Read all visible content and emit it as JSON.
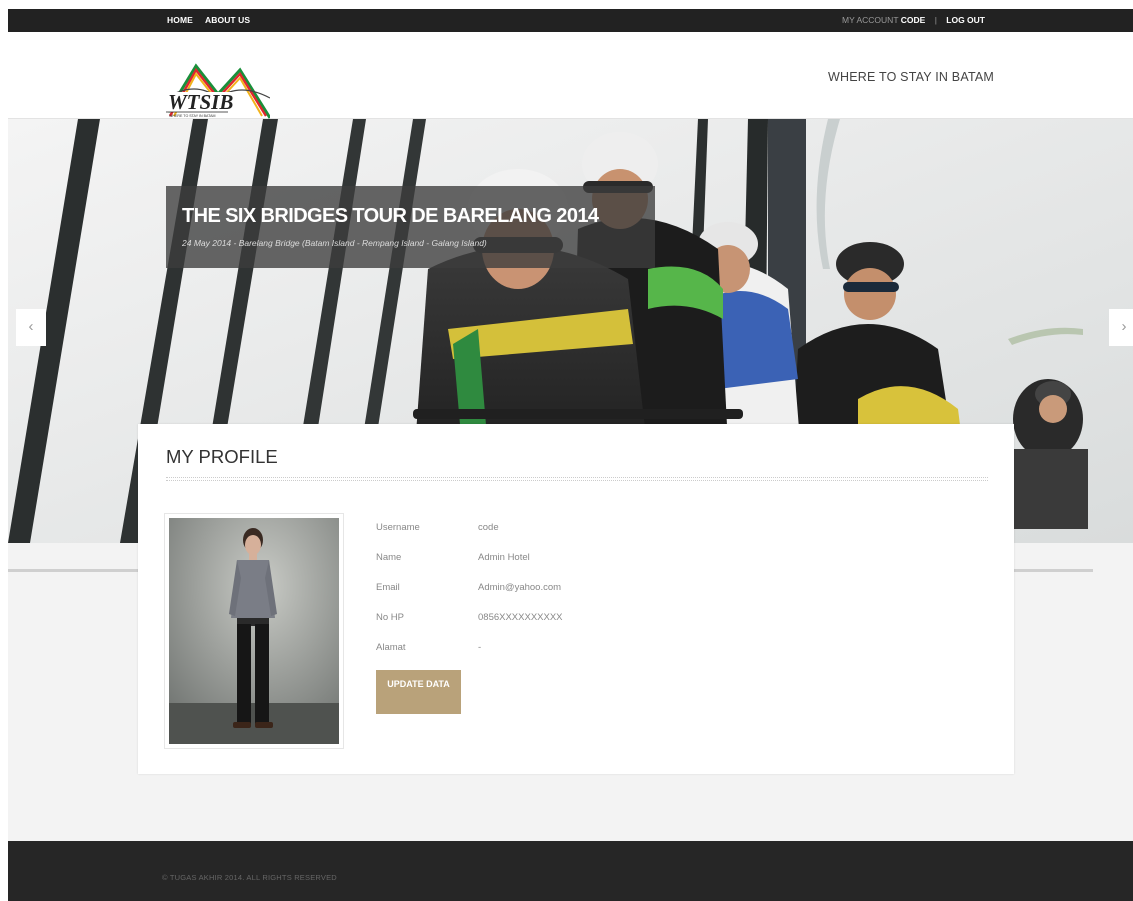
{
  "topbar": {
    "links": [
      {
        "label": "HOME"
      },
      {
        "label": "ABOUT US"
      }
    ],
    "account_label": "MY ACCOUNT",
    "username": "CODE",
    "separator": "|",
    "logout": "LOG OUT"
  },
  "header": {
    "logo_text": "WTSIB",
    "logo_subtext": "WHERE TO STAY IN BATAM",
    "tagline": "WHERE TO STAY IN BATAM"
  },
  "slider": {
    "title": "THE SIX BRIDGES TOUR DE BARELANG 2014",
    "subtitle": "24 May 2014 - Barelang Bridge (Batam Island - Rempang Island - Galang Island)",
    "prev_icon": "chevron-left-icon",
    "next_icon": "chevron-right-icon",
    "prev_glyph": "‹",
    "next_glyph": "›"
  },
  "profile": {
    "heading": "MY PROFILE",
    "fields": [
      {
        "label": "Username",
        "value": "code"
      },
      {
        "label": "Name",
        "value": "Admin Hotel"
      },
      {
        "label": "Email",
        "value": "Admin@yahoo.com"
      },
      {
        "label": "No HP",
        "value": "0856XXXXXXXXXX"
      },
      {
        "label": "Alamat",
        "value": "-"
      }
    ],
    "update_button": "UPDATE DATA"
  },
  "footer": {
    "copyright": "© TUGAS AKHIR 2014. ALL RIGHTS RESERVED"
  },
  "colors": {
    "topbar_bg": "#222222",
    "footer_bg": "#262626",
    "accent_button": "#b9a27a",
    "page_bg": "#f3f3f3"
  }
}
